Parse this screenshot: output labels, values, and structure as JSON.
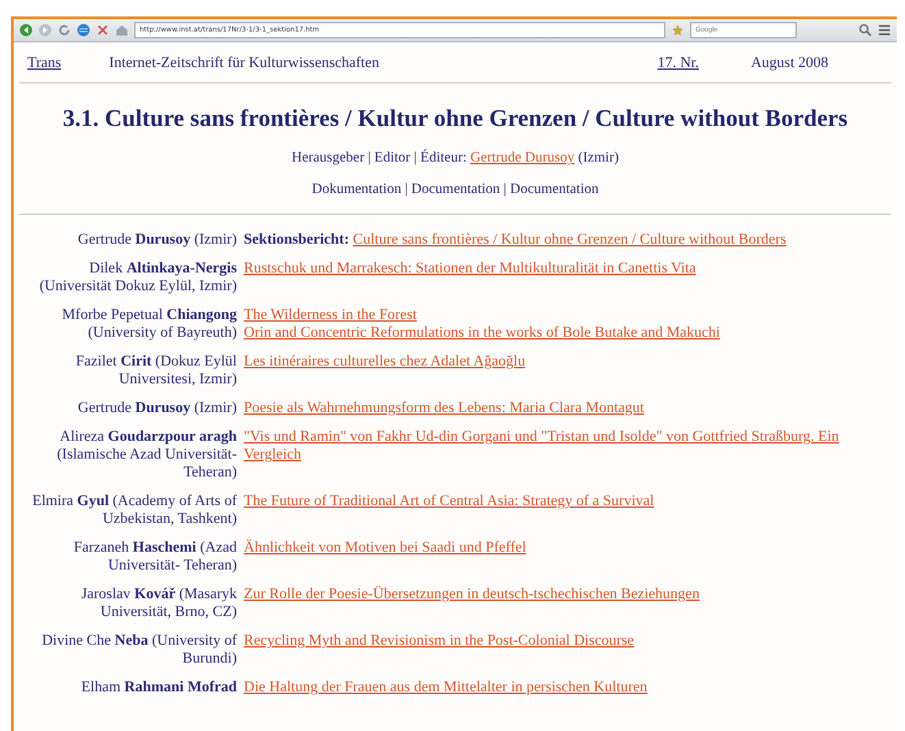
{
  "browser": {
    "address": "http://www.inst.at/trans/17Nr/3-1/3-1_sektion17.htm",
    "search_placeholder": "Google"
  },
  "header": {
    "journal_link": "Trans",
    "journal_subtitle": "Internet-Zeitschrift für Kulturwissenschaften",
    "issue_link": "17. Nr.",
    "date": "August 2008"
  },
  "title": "3.1. Culture sans frontières / Kultur ohne Grenzen / Culture without Borders",
  "editor": {
    "label": "Herausgeber | Editor | Éditeur:",
    "name_link": "Gertrude Durusoy",
    "place": "(Izmir)"
  },
  "documentation": "Dokumentation | Documentation | Documentation",
  "entries": [
    {
      "author": "Gertrude **Durusoy** (Izmir)",
      "prefix": "Sektionsbericht:",
      "links": [
        "Culture sans frontières / Kultur ohne Grenzen / Culture without Borders"
      ]
    },
    {
      "author": "Dilek **Altinkaya-Nergis** (Universität Dokuz Eylül, Izmir)",
      "links": [
        "Rustschuk und Marrakesch: Stationen der Multikulturalität in Canettis Vita"
      ]
    },
    {
      "author": "Mforbe Pepetual **Chiangong** (University of Bayreuth)",
      "links": [
        "The Wilderness in the Forest",
        "Orin and Concentric Reformulations in the works of Bole Butake and Makuchi"
      ]
    },
    {
      "author": "Fazilet **Cirit** (Dokuz Eylül Universitesi, Izmir)",
      "links": [
        "Les itinéraires culturelles chez Adalet Ağaoğlu"
      ]
    },
    {
      "author": "Gertrude **Durusoy** (Izmir)",
      "links": [
        "Poesie als Wahrnehmungsform des Lebens: Maria Clara Montagut"
      ]
    },
    {
      "author": "Alireza **Goudarzpour aragh** (Islamische Azad Universität-Teheran)",
      "links": [
        "\"Vis und Ramin\" von Fakhr Ud-din Gorgani und \"Tristan und Isolde\" von Gottfried Straßburg. Ein Vergleich"
      ]
    },
    {
      "author": "Elmira **Gyul** (Academy of Arts of Uzbekistan, Tashkent)",
      "links": [
        "The Future of Traditional Art of Central Asia: Strategy of a Survival"
      ]
    },
    {
      "author": "Farzaneh **Haschemi** (Azad Universität- Teheran)",
      "links": [
        "Ähnlichkeit von Motiven bei Saadi und Pfeffel"
      ]
    },
    {
      "author": "Jaroslav **Kovář** (Masaryk Universität, Brno, CZ)",
      "links": [
        "Zur Rolle der Poesie-Übersetzungen in deutsch-tschechischen Beziehungen"
      ]
    },
    {
      "author": "Divine Che **Neba** (University of Burundi)",
      "links": [
        "Recycling Myth and Revisionism in the Post-Colonial Discourse"
      ]
    },
    {
      "author": "Elham **Rahmani Mofrad**",
      "links": [
        "Die Haltung der Frauen aus dem Mittelalter in persischen Kulturen"
      ]
    }
  ]
}
